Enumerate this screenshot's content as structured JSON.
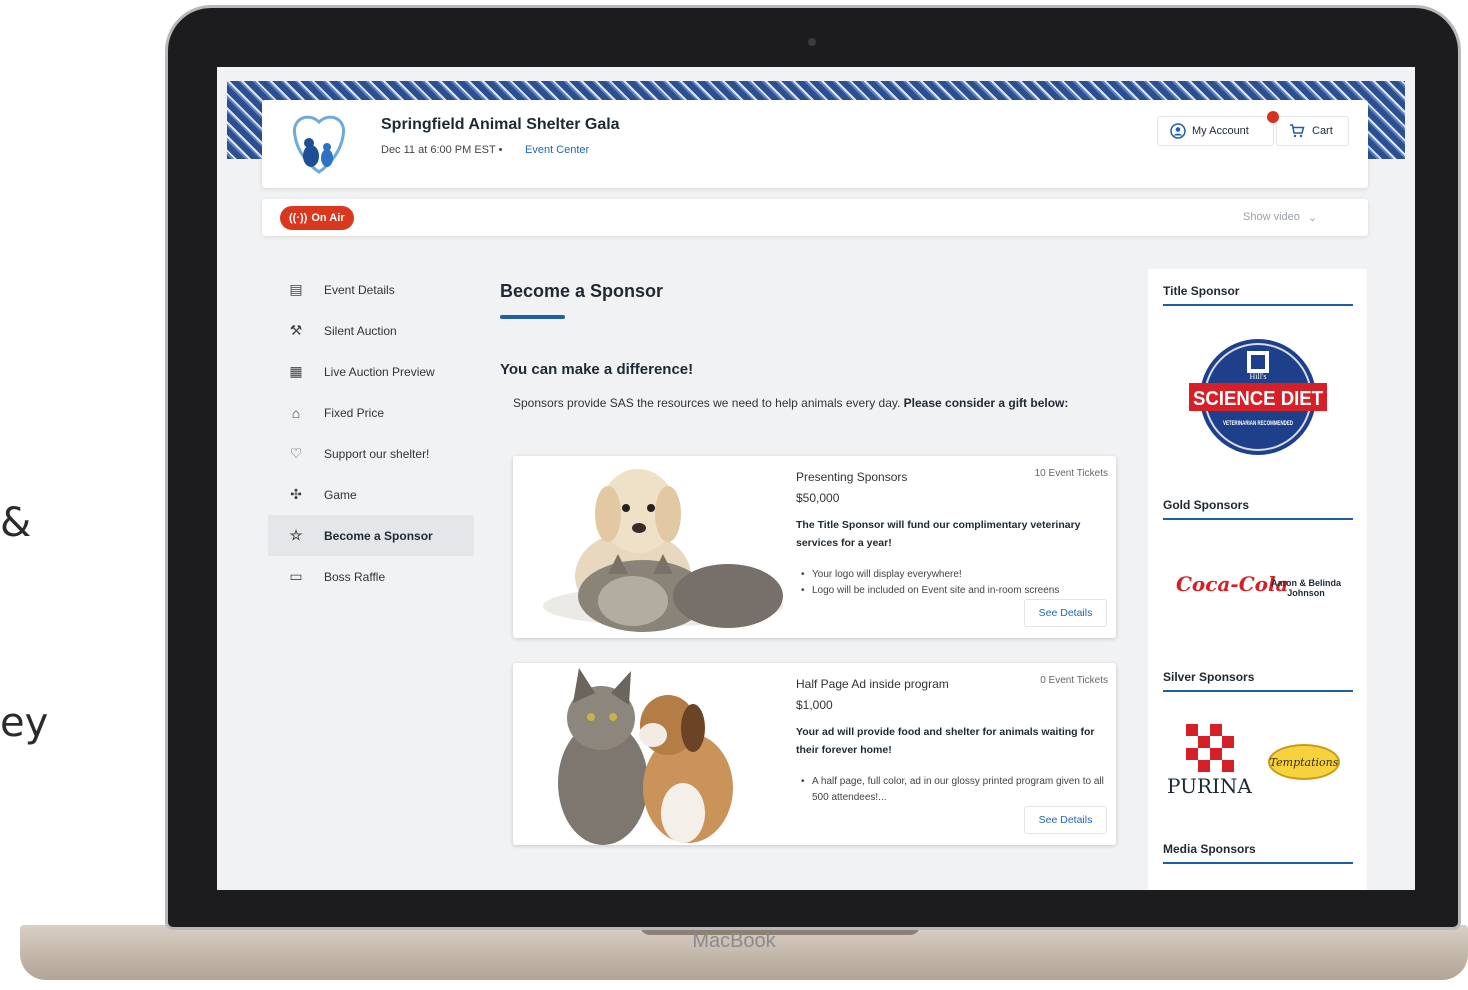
{
  "left_text": {
    "line1": "&",
    "line2": "ey"
  },
  "device": {
    "brand": "MacBook"
  },
  "header": {
    "event_title": "Springfield Animal Shelter Gala",
    "event_date": "Dec 11 at 6:00 PM EST •",
    "event_center": "Event Center",
    "my_account": "My Account",
    "cart": "Cart"
  },
  "broadcast": {
    "badge": "On Air",
    "show_video": "Show video"
  },
  "nav": {
    "items": [
      {
        "label": "Event Details",
        "icon": "calendar-icon"
      },
      {
        "label": "Silent Auction",
        "icon": "gavel-icon"
      },
      {
        "label": "Live Auction Preview",
        "icon": "preview-icon"
      },
      {
        "label": "Fixed Price",
        "icon": "tag-icon"
      },
      {
        "label": "Support our shelter!",
        "icon": "donate-hand-icon"
      },
      {
        "label": "Game",
        "icon": "puzzle-icon"
      },
      {
        "label": "Become a Sponsor",
        "icon": "star-icon",
        "active": true
      },
      {
        "label": "Boss Raffle",
        "icon": "ticket-icon"
      }
    ]
  },
  "main": {
    "title": "Become a Sponsor",
    "subheading": "You can make a difference!",
    "intro_plain": "Sponsors provide SAS the resources we need to help animals every day. ",
    "intro_bold": "Please consider a gift below:"
  },
  "cards": [
    {
      "name": "Presenting Sponsors",
      "tickets": "10 Event Tickets",
      "price": "$50,000",
      "description": "The Title Sponsor will fund our complimentary veterinary services for a year!",
      "bullets": [
        "Your logo will display everywhere!",
        "Logo will be included on Event site and in-room screens"
      ],
      "button": "See Details"
    },
    {
      "name": "Half Page Ad inside program",
      "tickets": "0 Event Tickets",
      "price": "$1,000",
      "description": "Your ad will provide food and shelter for animals waiting for their forever home!",
      "bullets": [
        "A half page, full color, ad in our glossy printed program given to all 500 attendees!..."
      ],
      "button": "See Details"
    }
  ],
  "sponsors": {
    "title_heading": "Title Sponsor",
    "title_logo": {
      "top": "Hill's",
      "main": "SCIENCE DIET",
      "sub": "VETERINARIAN RECOMMENDED"
    },
    "gold_heading": "Gold Sponsors",
    "gold_logos": [
      "Coca-Cola",
      "Aaron & Belinda Johnson"
    ],
    "silver_heading": "Silver Sponsors",
    "silver_logos": [
      "PURINA",
      "Temptations"
    ],
    "media_heading": "Media Sponsors"
  },
  "colors": {
    "accent": "#1e5fa8",
    "on_air": "#d9381f",
    "link": "#1e66b8"
  }
}
